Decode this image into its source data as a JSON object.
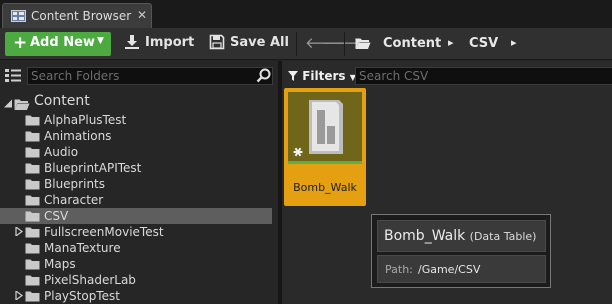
{
  "tab": {
    "label": "Content Browser",
    "close": "✕"
  },
  "toolbar": {
    "add_new_label": "Add New",
    "import_label": "Import",
    "save_all_label": "Save All",
    "back_glyph": "🡐",
    "forward_glyph": "🡒"
  },
  "breadcrumb": {
    "items": [
      "Content",
      "CSV"
    ],
    "separator": "▸"
  },
  "folders_panel": {
    "search_placeholder": "Search Folders",
    "root": "Content",
    "items": [
      {
        "label": "AlphaPlusTest",
        "expandable": false,
        "selected": false
      },
      {
        "label": "Animations",
        "expandable": false,
        "selected": false
      },
      {
        "label": "Audio",
        "expandable": false,
        "selected": false
      },
      {
        "label": "BlueprintAPITest",
        "expandable": false,
        "selected": false
      },
      {
        "label": "Blueprints",
        "expandable": false,
        "selected": false
      },
      {
        "label": "Character",
        "expandable": false,
        "selected": false
      },
      {
        "label": "CSV",
        "expandable": false,
        "selected": true
      },
      {
        "label": "FullscreenMovieTest",
        "expandable": true,
        "selected": false
      },
      {
        "label": "ManaTexture",
        "expandable": false,
        "selected": false
      },
      {
        "label": "Maps",
        "expandable": false,
        "selected": false
      },
      {
        "label": "PixelShaderLab",
        "expandable": false,
        "selected": false
      },
      {
        "label": "PlayStopTest",
        "expandable": true,
        "selected": false
      }
    ]
  },
  "assets_panel": {
    "filters_label": "Filters",
    "search_placeholder": "Search CSV",
    "assets": [
      {
        "name": "Bomb_Walk"
      }
    ]
  },
  "tooltip": {
    "title": "Bomb_Walk",
    "kind": "(Data Table)",
    "path_label": "Path:",
    "path_value": "/Game/CSV"
  },
  "colors": {
    "add_new": "#4caa41",
    "selected_tile": "#e4a010",
    "folder": "#c9c9c9",
    "selected_row": "#5e5e5e"
  },
  "icons": {
    "tab": "content-browser-icon",
    "import": "download-icon",
    "save_all": "floppy-disk-icon",
    "breadcrumb": "open-folder-icon",
    "search": "magnifier-icon",
    "tree_toggle": "tree-view-icon",
    "filters": "funnel-icon",
    "asset": "data-table-icon"
  }
}
